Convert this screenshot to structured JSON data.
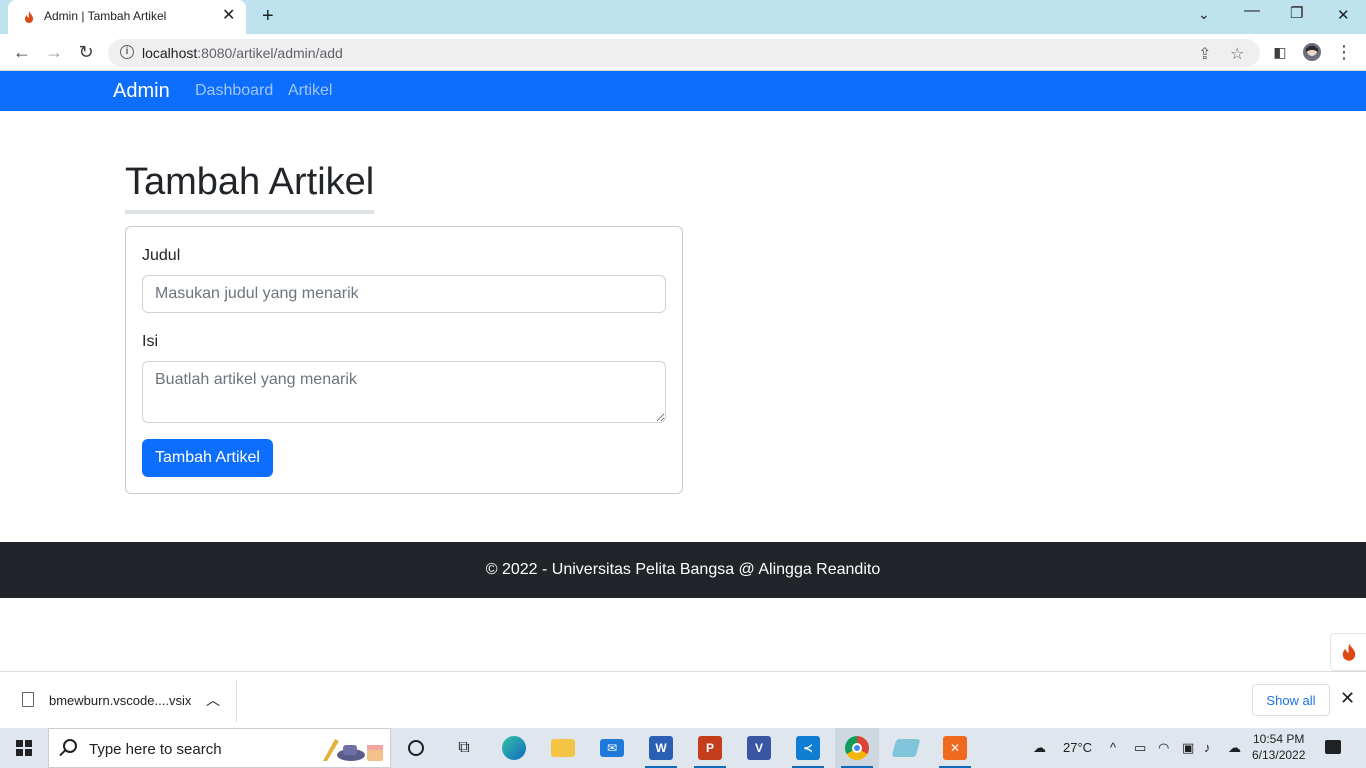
{
  "browser": {
    "tab_title": "Admin | Tambah Artikel",
    "url_host": "localhost",
    "url_rest": ":8080/artikel/admin/add"
  },
  "navbar": {
    "brand": "Admin",
    "links": [
      "Dashboard",
      "Artikel"
    ]
  },
  "page": {
    "title": "Tambah Artikel",
    "form": {
      "judul_label": "Judul",
      "judul_placeholder": "Masukan judul yang menarik",
      "isi_label": "Isi",
      "isi_placeholder": "Buatlah artikel yang menarik",
      "submit_label": "Tambah Artikel"
    }
  },
  "footer": {
    "text": "© 2022 - Universitas Pelita Bangsa @ Alingga Reandito"
  },
  "download_bar": {
    "file_name": "bmewburn.vscode....vsix",
    "show_all": "Show all"
  },
  "taskbar": {
    "search_placeholder": "Type here to search",
    "weather": "27°C",
    "time": "10:54 PM",
    "date": "6/13/2022"
  },
  "colors": {
    "primary": "#0d6efd",
    "footer_bg": "#212529",
    "tab_strip": "#bfe3ee"
  }
}
